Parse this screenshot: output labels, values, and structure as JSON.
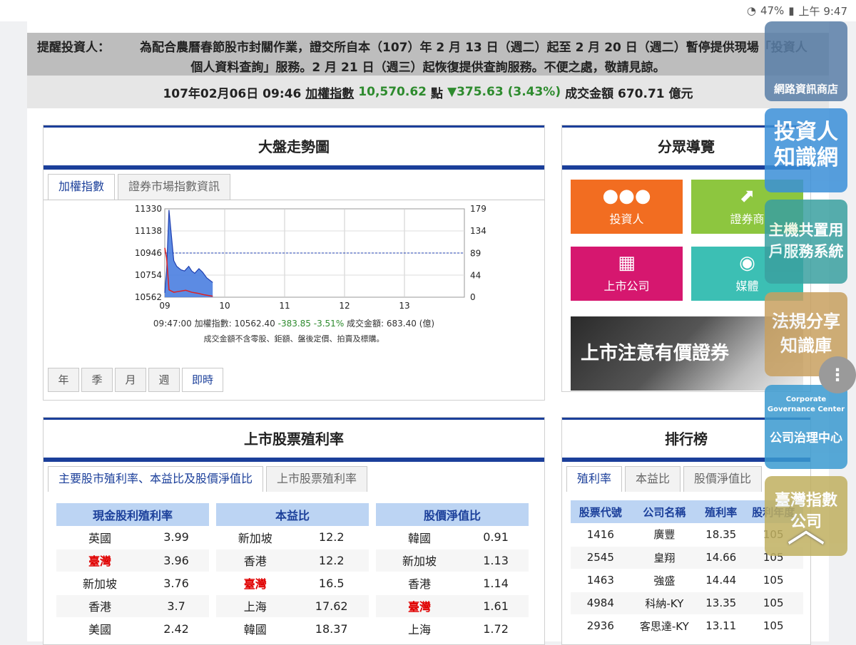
{
  "status_bar": {
    "battery": "47%",
    "time": "上午 9:47"
  },
  "notice": {
    "label": "提醒投資人：",
    "line1": "為配合農曆春節股市封關作業，證交所自本（107）年 2 月 13 日（週二）起至 2 月 20 日（週二）暫停提供現場「投資人",
    "line2": "個人資料查詢」服務。2 月 21 日（週三）起恢復提供查詢服務。不便之處，敬請見諒。"
  },
  "ticker": {
    "datetime": "107年02月06日 09:46",
    "index_label": "加權指數",
    "index_value": "10,570.62",
    "unit": "點",
    "change": "▼375.63 (3.43%)",
    "volume_label": "成交金額 670.71 億元"
  },
  "market_panel": {
    "title": "大盤走勢圖",
    "tabs": [
      "加權指數",
      "證券市場指數資訊"
    ],
    "info_time": "09:47:00",
    "info_index": "加權指數: 10562.40",
    "info_change": "-383.85",
    "info_pct": "-3.51%",
    "info_volume": "成交金額: 683.40 (億)",
    "info_note": "成交金額不含零股、鉅額、盤後定價、拍賣及標購。",
    "period_tabs": [
      "年",
      "季",
      "月",
      "週",
      "即時"
    ]
  },
  "chart_data": {
    "type": "area",
    "x_ticks": [
      "09",
      "10",
      "11",
      "12",
      "13"
    ],
    "y_left_ticks": [
      11330,
      11138,
      10946,
      10754,
      10562
    ],
    "y_right_ticks": [
      179,
      134,
      89,
      44,
      0
    ],
    "ylim_left": [
      10562,
      11330
    ],
    "ylim_right": [
      0,
      179
    ],
    "reference_level": 10946,
    "index_series": {
      "x": [
        9.0,
        9.03,
        9.07,
        9.15,
        9.2,
        9.27,
        9.33,
        9.4,
        9.45,
        9.5,
        9.57,
        9.63,
        9.7,
        9.8
      ],
      "y": [
        10600,
        10790,
        11320,
        10880,
        10830,
        10800,
        10790,
        10830,
        10790,
        10770,
        10810,
        10780,
        10730,
        10690
      ]
    },
    "volume_series": {
      "x": [
        9.0,
        9.03,
        9.07,
        9.15,
        9.25,
        9.35,
        9.45,
        9.55,
        9.65,
        9.8
      ],
      "y": [
        100,
        80,
        15,
        10,
        12,
        14,
        10,
        8,
        5,
        2
      ]
    },
    "colors": {
      "index_fill": "#4a7ee0",
      "index_line": "#1f3fb0",
      "volume_line": "#e02020",
      "reference": "#1f3fb0"
    }
  },
  "nav_panel": {
    "title": "分眾導覽",
    "tiles": [
      {
        "label": "投資人",
        "color": "#f26d21",
        "icon": "group-icon"
      },
      {
        "label": "證券商",
        "color": "#8dc63f",
        "icon": "chart-up-icon"
      },
      {
        "label": "上市公司",
        "color": "#d6176f",
        "icon": "building-icon"
      },
      {
        "label": "媒體",
        "color": "#3cbfb4",
        "icon": "broadcast-icon"
      }
    ],
    "banner": "上市注意有價證券"
  },
  "yield_panel": {
    "title": "上市股票殖利率",
    "tabs": [
      "主要股市殖利率、本益比及股價淨值比",
      "上市股票殖利率"
    ],
    "tables": [
      {
        "header": "現金股利殖利率",
        "rows": [
          [
            "英國",
            "3.99"
          ],
          [
            "臺灣",
            "3.96"
          ],
          [
            "新加坡",
            "3.76"
          ],
          [
            "香港",
            "3.7"
          ],
          [
            "美國",
            "2.42"
          ]
        ]
      },
      {
        "header": "本益比",
        "rows": [
          [
            "新加坡",
            "12.2"
          ],
          [
            "香港",
            "12.2"
          ],
          [
            "臺灣",
            "16.5"
          ],
          [
            "上海",
            "17.62"
          ],
          [
            "韓國",
            "18.37"
          ]
        ]
      },
      {
        "header": "股價淨值比",
        "rows": [
          [
            "韓國",
            "0.91"
          ],
          [
            "新加坡",
            "1.13"
          ],
          [
            "香港",
            "1.14"
          ],
          [
            "臺灣",
            "1.61"
          ],
          [
            "上海",
            "1.72"
          ]
        ]
      }
    ],
    "highlight": "臺灣"
  },
  "rank_panel": {
    "title": "排行榜",
    "tabs": [
      "殖利率",
      "本益比",
      "股價淨值比"
    ],
    "headers": [
      "股票代號",
      "公司名稱",
      "殖利率",
      "股利年度"
    ],
    "rows": [
      [
        "1416",
        "廣豐",
        "18.35",
        "105"
      ],
      [
        "2545",
        "皇翔",
        "14.66",
        "105"
      ],
      [
        "1463",
        "強盛",
        "14.44",
        "105"
      ],
      [
        "4984",
        "科納-KY",
        "13.35",
        "105"
      ],
      [
        "2936",
        "客思達-KY",
        "13.11",
        "105"
      ]
    ]
  },
  "floating_buttons": [
    {
      "label": "網路資訊商店",
      "color": "#5a7fa8"
    },
    {
      "label": "投資人知識網",
      "color": "#3a8fd8"
    },
    {
      "label": "主機共置用戶服務系統",
      "color": "#3aa0a0"
    },
    {
      "label": "法規分享知識庫",
      "color": "#c8a060"
    },
    {
      "label": "Corporate Governance Center",
      "label2": "公司治理中心",
      "color": "#3a9ad0"
    },
    {
      "label": "臺灣指數公司",
      "color": "#c0b060"
    }
  ]
}
